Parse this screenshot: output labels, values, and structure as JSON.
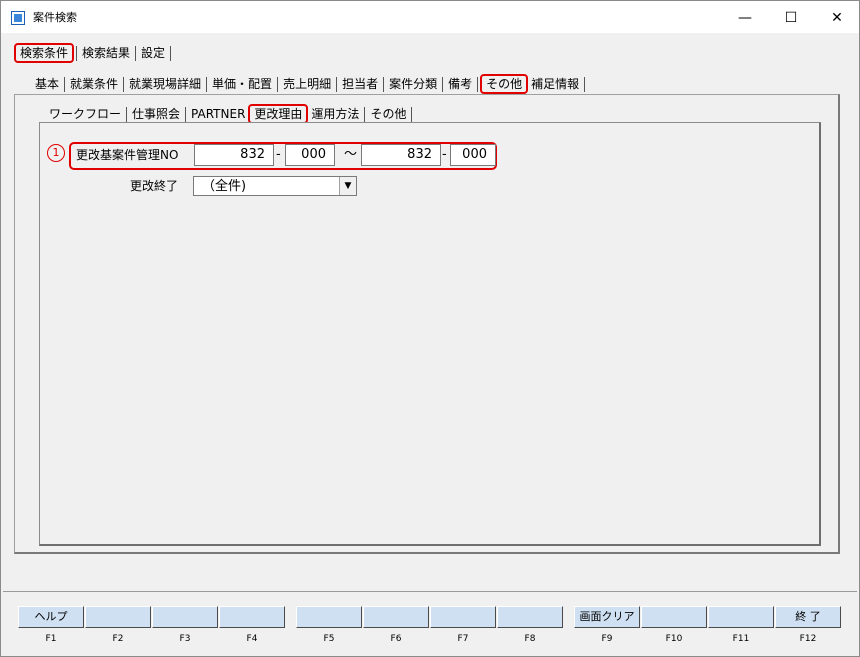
{
  "window": {
    "title": "案件検索",
    "minimize": "—",
    "maximize": "☐",
    "close": "✕"
  },
  "tabs_level1": [
    "検索条件",
    "検索結果",
    "設定"
  ],
  "tabs_level2": [
    "基本",
    "就業条件",
    "就業現場詳細",
    "単価・配置",
    "売上明細",
    "担当者",
    "案件分類",
    "備考",
    "その他",
    "補足情報"
  ],
  "tabs_level3": [
    "ワークフロー",
    "仕事照会",
    "PARTNER",
    "更改理由",
    "運用方法",
    "その他"
  ],
  "form": {
    "marker": "1",
    "mgmt_label": "更改基案件管理NO",
    "from_a": "832",
    "from_sep": "-",
    "from_b": "000",
    "tilde": "～",
    "to_a": "832",
    "to_sep": "-",
    "to_b": "000",
    "end_label": "更改終了",
    "end_value": "（全件)"
  },
  "fkeys": [
    {
      "label": "ヘルプ",
      "num": "F1"
    },
    {
      "label": "",
      "num": "F2"
    },
    {
      "label": "",
      "num": "F3"
    },
    {
      "label": "",
      "num": "F4"
    },
    {
      "label": "",
      "num": "F5"
    },
    {
      "label": "",
      "num": "F6"
    },
    {
      "label": "",
      "num": "F7"
    },
    {
      "label": "",
      "num": "F8"
    },
    {
      "label": "画面クリア",
      "num": "F9"
    },
    {
      "label": "",
      "num": "F10"
    },
    {
      "label": "",
      "num": "F11"
    },
    {
      "label": "終 了",
      "num": "F12"
    }
  ],
  "colors": {
    "highlight": "#e00000",
    "fkey_bg": "#cfe0f2",
    "window_bg": "#f0f0f0"
  }
}
